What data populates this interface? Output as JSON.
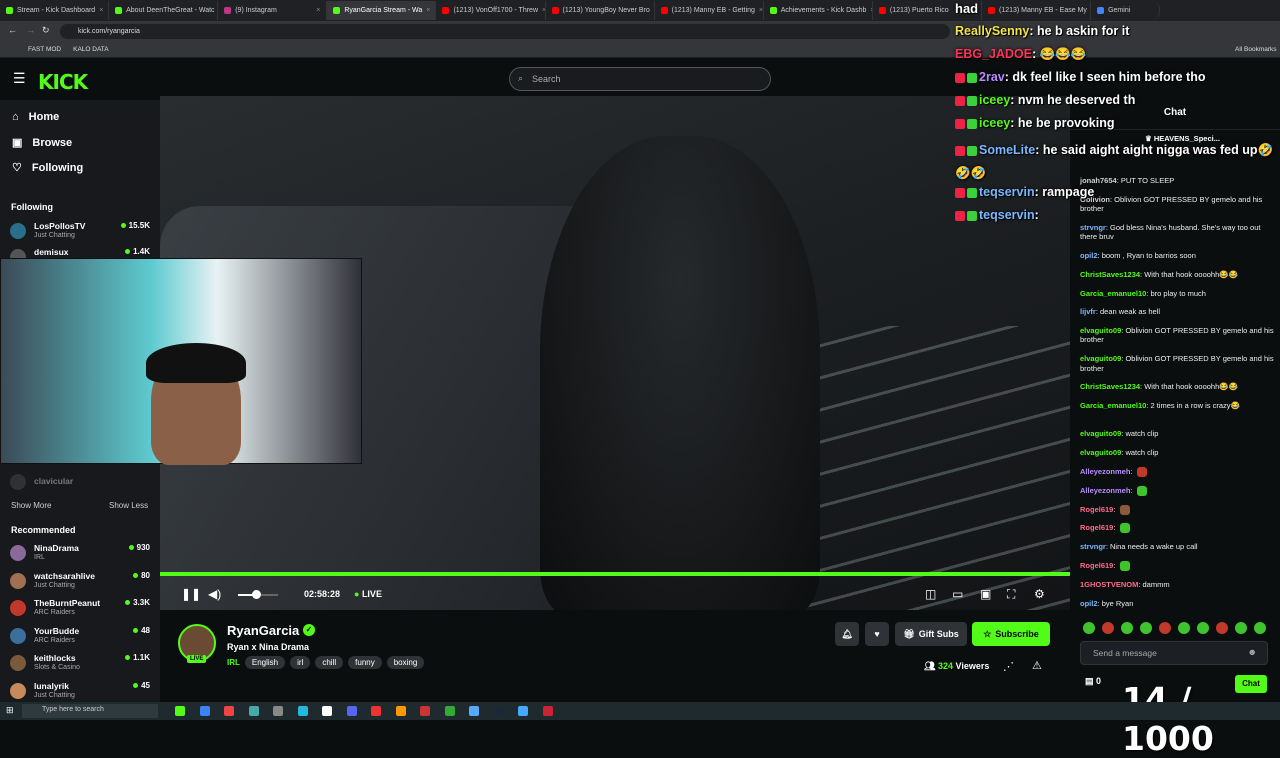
{
  "browser": {
    "tabs": [
      {
        "label": "Stream - Kick Dashboard",
        "color": "#53fc18"
      },
      {
        "label": "About DeenTheGreat - Watc",
        "color": "#53fc18"
      },
      {
        "label": "(9) Instagram",
        "color": "#c13584"
      },
      {
        "label": "RyanGarcia Stream - Wa",
        "color": "#53fc18",
        "active": true
      },
      {
        "label": "(1213) VonOff1700 - Threw",
        "color": "#ff0000"
      },
      {
        "label": "(1213) YoungBoy Never Bro",
        "color": "#ff0000"
      },
      {
        "label": "(1213) Manny EB - Getting",
        "color": "#ff0000"
      },
      {
        "label": "Achievements - Kick Dashb",
        "color": "#53fc18"
      },
      {
        "label": "(1213) Puerto Rico",
        "color": "#ff0000"
      },
      {
        "label": "(1213) Manny EB - Ease My",
        "color": "#ff0000"
      },
      {
        "label": "Gemini",
        "color": "#4285f4"
      }
    ],
    "url": "kick.com/ryangarcia",
    "bookmarks": [
      "FAST MOD",
      "KALO DATA"
    ],
    "all_bookmarks": "All Bookmarks"
  },
  "header": {
    "logo": "KICK",
    "search_placeholder": "Search"
  },
  "sidebar": {
    "nav": [
      {
        "label": "Home",
        "icon": "home-icon",
        "glyph": "⌂"
      },
      {
        "label": "Browse",
        "icon": "browse-icon",
        "glyph": "▣"
      },
      {
        "label": "Following",
        "icon": "heart-icon",
        "glyph": "♡"
      }
    ],
    "following_title": "Following",
    "following": [
      {
        "name": "LosPollosTV",
        "category": "Just Chatting",
        "viewers": "15.5K"
      },
      {
        "name": "demisux",
        "category": "",
        "viewers": "1.4K"
      }
    ],
    "offline": "clavicular",
    "show_more": "Show More",
    "show_less": "Show Less",
    "recommended_title": "Recommended",
    "recommended": [
      {
        "name": "NinaDrama",
        "category": "IRL",
        "viewers": "930"
      },
      {
        "name": "watchsarahlive",
        "category": "Just Chatting",
        "viewers": "80"
      },
      {
        "name": "TheBurntPeanut",
        "category": "ARC Raiders",
        "viewers": "3.3K"
      },
      {
        "name": "YourBudde",
        "category": "ARC Raiders",
        "viewers": "48"
      },
      {
        "name": "keithlocks",
        "category": "Slots & Casino",
        "viewers": "1.1K"
      },
      {
        "name": "lunalyrik",
        "category": "Just Chatting",
        "viewers": "45"
      }
    ]
  },
  "player": {
    "time": "02:58:28",
    "live_label": "LIVE",
    "volume_level": 0.45
  },
  "stream": {
    "streamer": "RyanGarcia",
    "title": "Ryan x Nina Drama",
    "category": "IRL",
    "tags": [
      "English",
      "irl",
      "chill",
      "funny",
      "boxing"
    ],
    "live_badge": "LIVE",
    "gift_label": "Gift Subs",
    "subscribe_label": "Subscribe",
    "viewers": "324",
    "viewers_label": "Viewers"
  },
  "chat": {
    "title": "Chat",
    "pinned": "HEAVENS_Speci...",
    "messages": [
      {
        "user": "jonah7654",
        "color": "#cfcfcf",
        "text": "PUT TO SLEEP"
      },
      {
        "user": "Oblivion",
        "color": "#cfcfcf",
        "text": "Oblivion GOT PRESSED BY gemelo and his brother"
      },
      {
        "user": "strvngr",
        "color": "#7ab8ff",
        "text": "God bless Nina's husband. She's way too out there bruv"
      },
      {
        "user": "opil2",
        "color": "#7ab8ff",
        "text": "boom , Ryan to barrios soon"
      },
      {
        "user": "ChristSaves1234",
        "color": "#53fc18",
        "text": "With that hook oooohh😂😂"
      },
      {
        "user": "Garcia_emanuel10",
        "color": "#53fc18",
        "text": "bro play to much"
      },
      {
        "user": "lijvfr",
        "color": "#7ab8ff",
        "text": "dean weak as hell"
      },
      {
        "user": "elvaguito09",
        "color": "#53fc18",
        "text": "Oblivion GOT PRESSED BY gemelo and his brother"
      },
      {
        "user": "elvaguito09",
        "color": "#53fc18",
        "text": "Oblivion GOT PRESSED BY gemelo and his brother"
      },
      {
        "user": "ChristSaves1234",
        "color": "#53fc18",
        "text": "With that hook oooohh😂😂"
      },
      {
        "user": "Garcia_emanuel10",
        "color": "#53fc18",
        "text": "2 times in a row is crazy😂"
      },
      {
        "user": "elvaguito09",
        "color": "#53fc18",
        "text": "watch clip"
      },
      {
        "user": "elvaguito09",
        "color": "#53fc18",
        "text": "watch clip"
      },
      {
        "user": "Alleyezonmeh",
        "color": "#b88cff",
        "text": ""
      },
      {
        "user": "Alleyezonmeh",
        "color": "#b88cff",
        "text": ""
      },
      {
        "user": "Rogel619",
        "color": "#ff6b8b",
        "text": ""
      },
      {
        "user": "Rogel619",
        "color": "#ff6b8b",
        "text": ""
      },
      {
        "user": "strvngr",
        "color": "#7ab8ff",
        "text": "Nina needs a wake up call"
      },
      {
        "user": "Rogel619",
        "color": "#ff6b8b",
        "text": ""
      },
      {
        "user": "1GHOSTVENOM",
        "color": "#ff6b8b",
        "text": "dammm"
      },
      {
        "user": "opil2",
        "color": "#7ab8ff",
        "text": "bye Ryan"
      }
    ],
    "input_placeholder": "Send a message",
    "points": "0",
    "send_label": "Chat"
  },
  "overlay": {
    "top_word": "had",
    "lines": [
      {
        "user": "ReallySenny",
        "color": "#f2e34c",
        "text": "he b askin for it"
      },
      {
        "user": "EBG_JADOE",
        "color": "#ff3355",
        "text": "😂😂😂"
      },
      {
        "user": "2rav",
        "color": "#b88cff",
        "text": "dk feel like I seen him before tho"
      },
      {
        "user": "iceey",
        "color": "#53fc18",
        "text": "nvm he deserved th"
      },
      {
        "user": "iceey",
        "color": "#53fc18",
        "text": "he be provoking"
      },
      {
        "user": "SomeLite",
        "color": "#7ab8ff",
        "text": "he said aight aight nigga was fed up🤣🤣🤣"
      },
      {
        "user": "teqservin",
        "color": "#7ab8ff",
        "text": "rampage"
      },
      {
        "user": "teqservin",
        "color": "#7ab8ff",
        "text": ""
      }
    ],
    "counter": "14 / 1000"
  },
  "taskbar": {
    "search_placeholder": "Type here to search"
  }
}
